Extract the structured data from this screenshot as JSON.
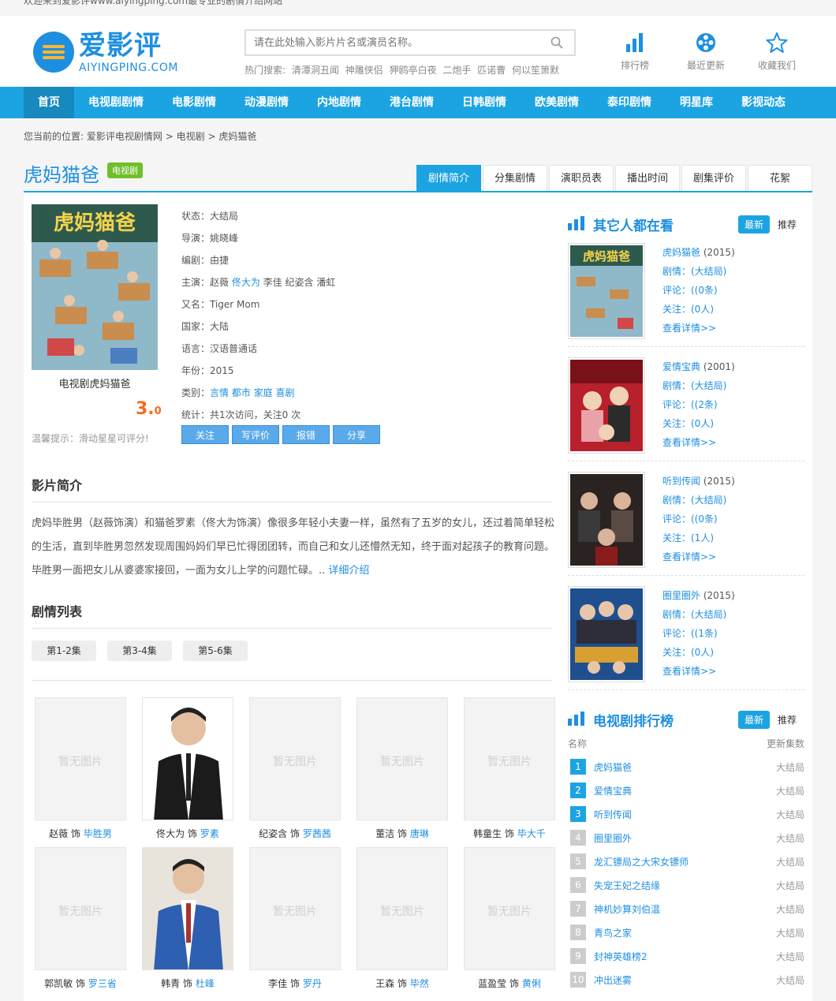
{
  "topbar": {
    "welcome": "欢迎来到爱影评www.aiyingping.com最专业的剧情介绍网站"
  },
  "logo": {
    "cn": "爱影评",
    "en": "AIYINGPING.COM"
  },
  "search": {
    "placeholder": "请在此处输入影片片名或演员名称。"
  },
  "hot": {
    "label": "热门搜索:",
    "items": [
      "清潭洞丑闻",
      "神雕侠侣",
      "狎鸥亭白夜",
      "二炮手",
      "匹诺曹",
      "何以笙箫默"
    ]
  },
  "header_icons": [
    {
      "label": "排行榜",
      "icon": "bar-chart-icon"
    },
    {
      "label": "最近更新",
      "icon": "film-reel-icon"
    },
    {
      "label": "收藏我们",
      "icon": "star-icon"
    }
  ],
  "nav": [
    "首页",
    "电视剧剧情",
    "电影剧情",
    "动漫剧情",
    "内地剧情",
    "港台剧情",
    "日韩剧情",
    "欧美剧情",
    "泰印剧情",
    "明星库",
    "影视动态"
  ],
  "breadcrumb": {
    "prefix": "您当前的位置:",
    "items": [
      "爱影评电视剧情网",
      "电视剧",
      "虎妈猫爸"
    ],
    "sep": ">"
  },
  "title": {
    "name": "虎妈猫爸",
    "tag": "电视剧"
  },
  "tabs": [
    "剧情简介",
    "分集剧情",
    "演职员表",
    "播出时间",
    "剧集评价",
    "花絮"
  ],
  "poster": {
    "caption": "电视剧虎妈猫爸",
    "score_int": "3.",
    "score_dec": "0",
    "tip": "温馨提示：滑动星星可评分!"
  },
  "info": {
    "status": "状态：大结局",
    "director": "导演：姚晓峰",
    "writer": "编剧：由捷",
    "actors_label": "主演：",
    "actors": [
      "赵薇",
      "佟大为",
      "李佳",
      "纪姿含",
      "潘虹"
    ],
    "alias": "又名：Tiger Mom",
    "country": "国家：大陆",
    "language": "语言：汉语普通话",
    "year": "年份：2015",
    "genre_label": "类别：",
    "genres": [
      "言情",
      "都市",
      "家庭",
      "喜剧"
    ],
    "stats": "统计：共1次访问，关注0 次"
  },
  "buttons": [
    "关注",
    "写评价",
    "报错",
    "分享"
  ],
  "intro": {
    "title": "影片简介",
    "text": "虎妈毕胜男（赵薇饰演）和猫爸罗素（佟大为饰演）像很多年轻小夫妻一样，虽然有了五岁的女儿，还过着简单轻松的生活，直到毕胜男忽然发现周围妈妈们早已忙得团团转，而自己和女儿还懵然无知，终于面对起孩子的教育问题。毕胜男一面把女儿从婆婆家接回，一面为女儿上学的问题忙碌。..",
    "more": "详细介绍"
  },
  "episodes": {
    "title": "剧情列表",
    "items": [
      "第1-2集",
      "第3-4集",
      "第5-6集"
    ]
  },
  "cast": {
    "no_image": "暂无图片",
    "role_word": "饰",
    "items": [
      {
        "actor": "赵薇",
        "role": "毕胜男",
        "photo": false
      },
      {
        "actor": "佟大为",
        "role": "罗素",
        "photo": true
      },
      {
        "actor": "纪姿含",
        "role": "罗茜茜",
        "photo": false
      },
      {
        "actor": "董洁",
        "role": "唐琳",
        "photo": false
      },
      {
        "actor": "韩童生",
        "role": "毕大千",
        "photo": false
      },
      {
        "actor": "郭凯敏",
        "role": "罗三省",
        "photo": false
      },
      {
        "actor": "韩青",
        "role": "杜峰",
        "photo": true
      },
      {
        "actor": "李佳",
        "role": "罗丹",
        "photo": false
      },
      {
        "actor": "王森",
        "role": "毕然",
        "photo": false
      },
      {
        "actor": "蓝盈莹",
        "role": "黄俐",
        "photo": false
      }
    ]
  },
  "sidebar": {
    "others_title": "其它人都在看",
    "tab_new": "最新",
    "tab_rec": "推荐",
    "related": [
      {
        "name": "虎妈猫爸",
        "year": "(2015)",
        "plot": "剧情：(大结局)",
        "comments": "评论：((0条)",
        "follows": "关注：(0人)",
        "more": "查看详情>>"
      },
      {
        "name": "爱情宝典",
        "year": "(2001)",
        "plot": "剧情：(大结局)",
        "comments": "评论：((2条)",
        "follows": "关注：(0人)",
        "more": "查看详情>>"
      },
      {
        "name": "听到传闻",
        "year": "(2015)",
        "plot": "剧情：(大结局)",
        "comments": "评论：((0条)",
        "follows": "关注：(1人)",
        "more": "查看详情>>"
      },
      {
        "name": "圈里圈外",
        "year": "(2015)",
        "plot": "剧情：(大结局)",
        "comments": "评论：((1条)",
        "follows": "关注：(0人)",
        "more": "查看详情>>"
      }
    ],
    "rank_title": "电视剧排行榜",
    "rank_col_name": "名称",
    "rank_col_update": "更新集数",
    "rank": [
      {
        "n": "1",
        "name": "虎妈猫爸",
        "status": "大结局"
      },
      {
        "n": "2",
        "name": "爱情宝典",
        "status": "大结局"
      },
      {
        "n": "3",
        "name": "听到传闻",
        "status": "大结局"
      },
      {
        "n": "4",
        "name": "圈里圈外",
        "status": "大结局"
      },
      {
        "n": "5",
        "name": "龙汇镖局之大宋女镖师",
        "status": "大结局"
      },
      {
        "n": "6",
        "name": "失宠王妃之结缘",
        "status": "大结局"
      },
      {
        "n": "7",
        "name": "神机妙算刘伯温",
        "status": "大结局"
      },
      {
        "n": "8",
        "name": "青鸟之家",
        "status": "大结局"
      },
      {
        "n": "9",
        "name": "封神英雄榜2",
        "status": "大结局"
      },
      {
        "n": "10",
        "name": "冲出迷雾",
        "status": "大结局"
      }
    ]
  }
}
